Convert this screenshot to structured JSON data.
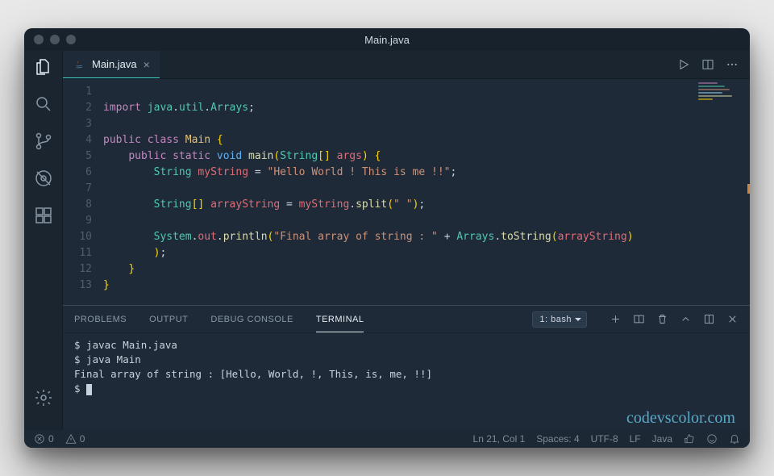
{
  "window": {
    "title": "Main.java"
  },
  "tab": {
    "filename": "Main.java"
  },
  "editor": {
    "lines": [
      "",
      "import java.util.Arrays;",
      "",
      "public class Main {",
      "    public static void main(String[] args) {",
      "        String myString = \"Hello World ! This is me !!\";",
      "",
      "        String[] arrayString = myString.split(\" \");",
      "",
      "        System.out.println(\"Final array of string : \" + Arrays.toString(arrayString)",
      "        );",
      "    }",
      "}"
    ],
    "line_numbers": [
      "1",
      "2",
      "3",
      "4",
      "5",
      "6",
      "7",
      "8",
      "9",
      "10",
      "11",
      "12",
      "13"
    ]
  },
  "panel": {
    "tabs": {
      "problems": "PROBLEMS",
      "output": "OUTPUT",
      "debug": "DEBUG CONSOLE",
      "terminal": "TERMINAL"
    },
    "active_tab": "terminal",
    "terminal_selector": "1: bash",
    "terminal_lines": [
      "$ javac Main.java",
      "$ java Main",
      "Final array of string : [Hello, World, !, This, is, me, !!]",
      "$ "
    ]
  },
  "watermark": "codevscolor.com",
  "status": {
    "errors": "0",
    "warnings": "0",
    "cursor": "Ln 21, Col 1",
    "spaces": "Spaces: 4",
    "encoding": "UTF-8",
    "eol": "LF",
    "language": "Java"
  },
  "icons": {
    "explorer": "files-icon",
    "search": "search-icon",
    "scm": "branch-icon",
    "debug": "debug-icon",
    "extensions": "extensions-icon",
    "settings": "gear-icon",
    "run": "play-icon",
    "split": "split-icon",
    "more": "ellipsis-icon",
    "plus": "plus-icon",
    "split_term": "split-icon",
    "trash": "trash-icon",
    "up": "chevron-up-icon",
    "maximize": "maximize-icon",
    "close": "close-icon",
    "error": "error-icon",
    "warning": "warning-icon",
    "thumb": "thumbs-up-icon",
    "smile": "smile-icon",
    "bell": "bell-icon"
  }
}
